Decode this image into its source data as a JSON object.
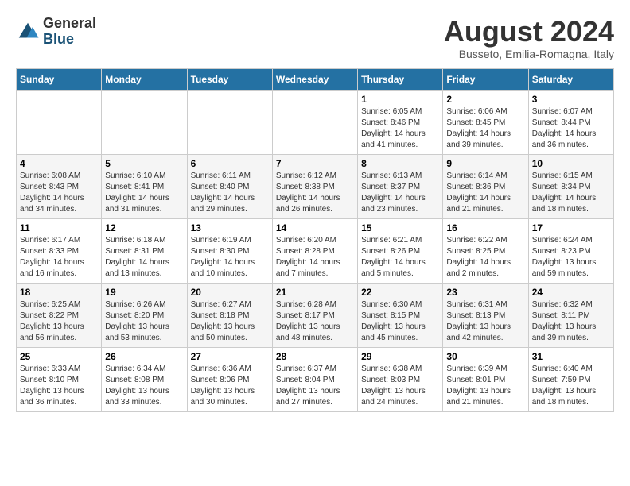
{
  "header": {
    "logo_general": "General",
    "logo_blue": "Blue",
    "month_year": "August 2024",
    "location": "Busseto, Emilia-Romagna, Italy"
  },
  "weekdays": [
    "Sunday",
    "Monday",
    "Tuesday",
    "Wednesday",
    "Thursday",
    "Friday",
    "Saturday"
  ],
  "weeks": [
    [
      {
        "day": "",
        "info": ""
      },
      {
        "day": "",
        "info": ""
      },
      {
        "day": "",
        "info": ""
      },
      {
        "day": "",
        "info": ""
      },
      {
        "day": "1",
        "info": "Sunrise: 6:05 AM\nSunset: 8:46 PM\nDaylight: 14 hours\nand 41 minutes."
      },
      {
        "day": "2",
        "info": "Sunrise: 6:06 AM\nSunset: 8:45 PM\nDaylight: 14 hours\nand 39 minutes."
      },
      {
        "day": "3",
        "info": "Sunrise: 6:07 AM\nSunset: 8:44 PM\nDaylight: 14 hours\nand 36 minutes."
      }
    ],
    [
      {
        "day": "4",
        "info": "Sunrise: 6:08 AM\nSunset: 8:43 PM\nDaylight: 14 hours\nand 34 minutes."
      },
      {
        "day": "5",
        "info": "Sunrise: 6:10 AM\nSunset: 8:41 PM\nDaylight: 14 hours\nand 31 minutes."
      },
      {
        "day": "6",
        "info": "Sunrise: 6:11 AM\nSunset: 8:40 PM\nDaylight: 14 hours\nand 29 minutes."
      },
      {
        "day": "7",
        "info": "Sunrise: 6:12 AM\nSunset: 8:38 PM\nDaylight: 14 hours\nand 26 minutes."
      },
      {
        "day": "8",
        "info": "Sunrise: 6:13 AM\nSunset: 8:37 PM\nDaylight: 14 hours\nand 23 minutes."
      },
      {
        "day": "9",
        "info": "Sunrise: 6:14 AM\nSunset: 8:36 PM\nDaylight: 14 hours\nand 21 minutes."
      },
      {
        "day": "10",
        "info": "Sunrise: 6:15 AM\nSunset: 8:34 PM\nDaylight: 14 hours\nand 18 minutes."
      }
    ],
    [
      {
        "day": "11",
        "info": "Sunrise: 6:17 AM\nSunset: 8:33 PM\nDaylight: 14 hours\nand 16 minutes."
      },
      {
        "day": "12",
        "info": "Sunrise: 6:18 AM\nSunset: 8:31 PM\nDaylight: 14 hours\nand 13 minutes."
      },
      {
        "day": "13",
        "info": "Sunrise: 6:19 AM\nSunset: 8:30 PM\nDaylight: 14 hours\nand 10 minutes."
      },
      {
        "day": "14",
        "info": "Sunrise: 6:20 AM\nSunset: 8:28 PM\nDaylight: 14 hours\nand 7 minutes."
      },
      {
        "day": "15",
        "info": "Sunrise: 6:21 AM\nSunset: 8:26 PM\nDaylight: 14 hours\nand 5 minutes."
      },
      {
        "day": "16",
        "info": "Sunrise: 6:22 AM\nSunset: 8:25 PM\nDaylight: 14 hours\nand 2 minutes."
      },
      {
        "day": "17",
        "info": "Sunrise: 6:24 AM\nSunset: 8:23 PM\nDaylight: 13 hours\nand 59 minutes."
      }
    ],
    [
      {
        "day": "18",
        "info": "Sunrise: 6:25 AM\nSunset: 8:22 PM\nDaylight: 13 hours\nand 56 minutes."
      },
      {
        "day": "19",
        "info": "Sunrise: 6:26 AM\nSunset: 8:20 PM\nDaylight: 13 hours\nand 53 minutes."
      },
      {
        "day": "20",
        "info": "Sunrise: 6:27 AM\nSunset: 8:18 PM\nDaylight: 13 hours\nand 50 minutes."
      },
      {
        "day": "21",
        "info": "Sunrise: 6:28 AM\nSunset: 8:17 PM\nDaylight: 13 hours\nand 48 minutes."
      },
      {
        "day": "22",
        "info": "Sunrise: 6:30 AM\nSunset: 8:15 PM\nDaylight: 13 hours\nand 45 minutes."
      },
      {
        "day": "23",
        "info": "Sunrise: 6:31 AM\nSunset: 8:13 PM\nDaylight: 13 hours\nand 42 minutes."
      },
      {
        "day": "24",
        "info": "Sunrise: 6:32 AM\nSunset: 8:11 PM\nDaylight: 13 hours\nand 39 minutes."
      }
    ],
    [
      {
        "day": "25",
        "info": "Sunrise: 6:33 AM\nSunset: 8:10 PM\nDaylight: 13 hours\nand 36 minutes."
      },
      {
        "day": "26",
        "info": "Sunrise: 6:34 AM\nSunset: 8:08 PM\nDaylight: 13 hours\nand 33 minutes."
      },
      {
        "day": "27",
        "info": "Sunrise: 6:36 AM\nSunset: 8:06 PM\nDaylight: 13 hours\nand 30 minutes."
      },
      {
        "day": "28",
        "info": "Sunrise: 6:37 AM\nSunset: 8:04 PM\nDaylight: 13 hours\nand 27 minutes."
      },
      {
        "day": "29",
        "info": "Sunrise: 6:38 AM\nSunset: 8:03 PM\nDaylight: 13 hours\nand 24 minutes."
      },
      {
        "day": "30",
        "info": "Sunrise: 6:39 AM\nSunset: 8:01 PM\nDaylight: 13 hours\nand 21 minutes."
      },
      {
        "day": "31",
        "info": "Sunrise: 6:40 AM\nSunset: 7:59 PM\nDaylight: 13 hours\nand 18 minutes."
      }
    ]
  ]
}
